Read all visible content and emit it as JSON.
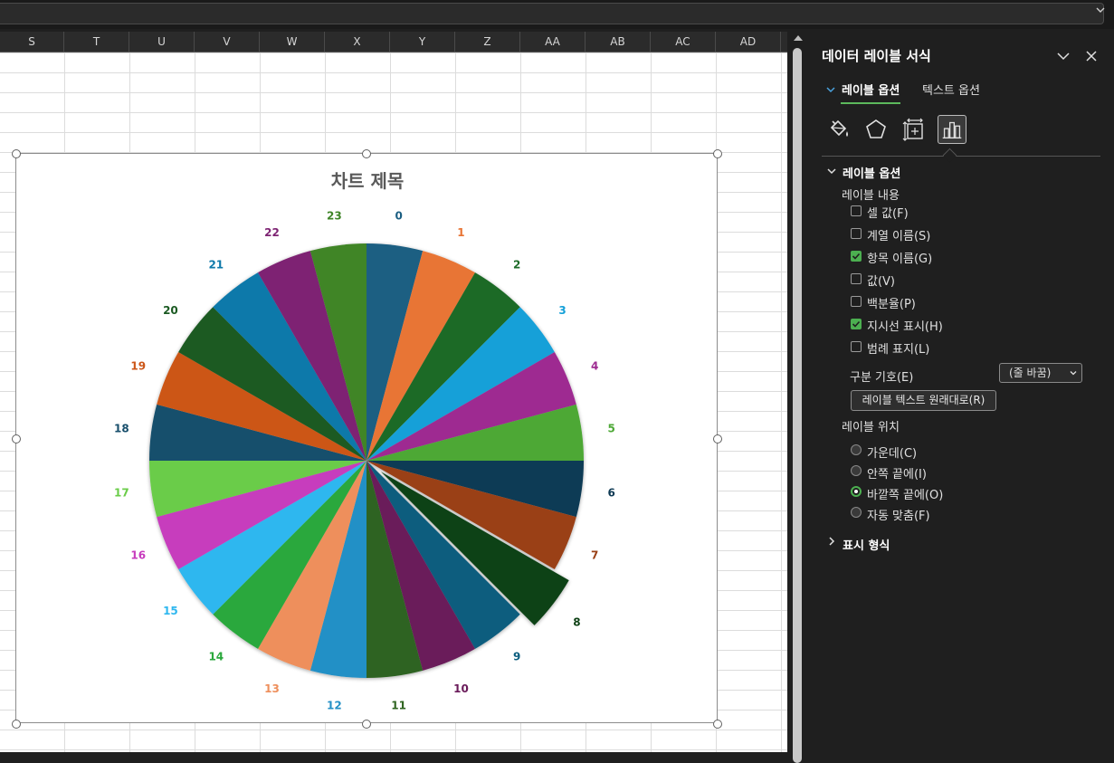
{
  "spreadsheet": {
    "columns": [
      "S",
      "T",
      "U",
      "V",
      "W",
      "X",
      "Y",
      "Z",
      "AA",
      "AB",
      "AC",
      "AD"
    ]
  },
  "chart": {
    "title": "차트 제목"
  },
  "chart_data": {
    "type": "pie",
    "title": "차트 제목",
    "categories": [
      "0",
      "1",
      "2",
      "3",
      "4",
      "5",
      "6",
      "7",
      "8",
      "9",
      "10",
      "11",
      "12",
      "13",
      "14",
      "15",
      "16",
      "17",
      "18",
      "19",
      "20",
      "21",
      "22",
      "23"
    ],
    "values": [
      1,
      1,
      1,
      1,
      1,
      1,
      1,
      1,
      1,
      1,
      1,
      1,
      1,
      1,
      1,
      1,
      1,
      1,
      1,
      1,
      1,
      1,
      1,
      1
    ],
    "colors": [
      "#1b5e82",
      "#e87434",
      "#1d6b28",
      "#14a0d8",
      "#9e2b91",
      "#4da836",
      "#0e3a54",
      "#9a4016",
      "#0f4216",
      "#0b5d7e",
      "#6a1b5a",
      "#2f6420",
      "#2490c6",
      "#ee8f5c",
      "#2aa83c",
      "#2eb7ef",
      "#c73cbd",
      "#6acc48",
      "#184f6c",
      "#cc5618",
      "#1b5a22",
      "#0e79aa",
      "#7e2473",
      "#3f8528"
    ],
    "exploded_category": "8",
    "labels_position": "outside-end",
    "legend": "none"
  },
  "panel": {
    "title": "데이터 레이블 서식",
    "tabs": {
      "label_options": "레이블 옵션",
      "text_options": "텍스트 옵션"
    },
    "icons": [
      "fill-line-icon",
      "effects-icon",
      "size-properties-icon",
      "label-options-icon"
    ],
    "section_label_options": "레이블 옵션",
    "label_contains": "레이블 내용",
    "checkboxes": [
      {
        "label": "셀 값(F)",
        "checked": false
      },
      {
        "label": "계열 이름(S)",
        "checked": false
      },
      {
        "label": "항목 이름(G)",
        "checked": true
      },
      {
        "label": "값(V)",
        "checked": false
      },
      {
        "label": "백분율(P)",
        "checked": false
      },
      {
        "label": "지시선 표시(H)",
        "checked": true
      },
      {
        "label": "범례 표지(L)",
        "checked": false
      }
    ],
    "separator_label": "구분 기호(E)",
    "separator_value": "(줄 바꿈)",
    "reset_button": "레이블 텍스트 원래대로(R)",
    "label_position": "레이블 위치",
    "positions": [
      {
        "label": "가운데(C)",
        "checked": false
      },
      {
        "label": "안쪽 끝에(I)",
        "checked": false
      },
      {
        "label": "바깥쪽 끝에(O)",
        "checked": true
      },
      {
        "label": "자동 맞춤(F)",
        "checked": false
      }
    ],
    "section_number": "표시 형식"
  }
}
